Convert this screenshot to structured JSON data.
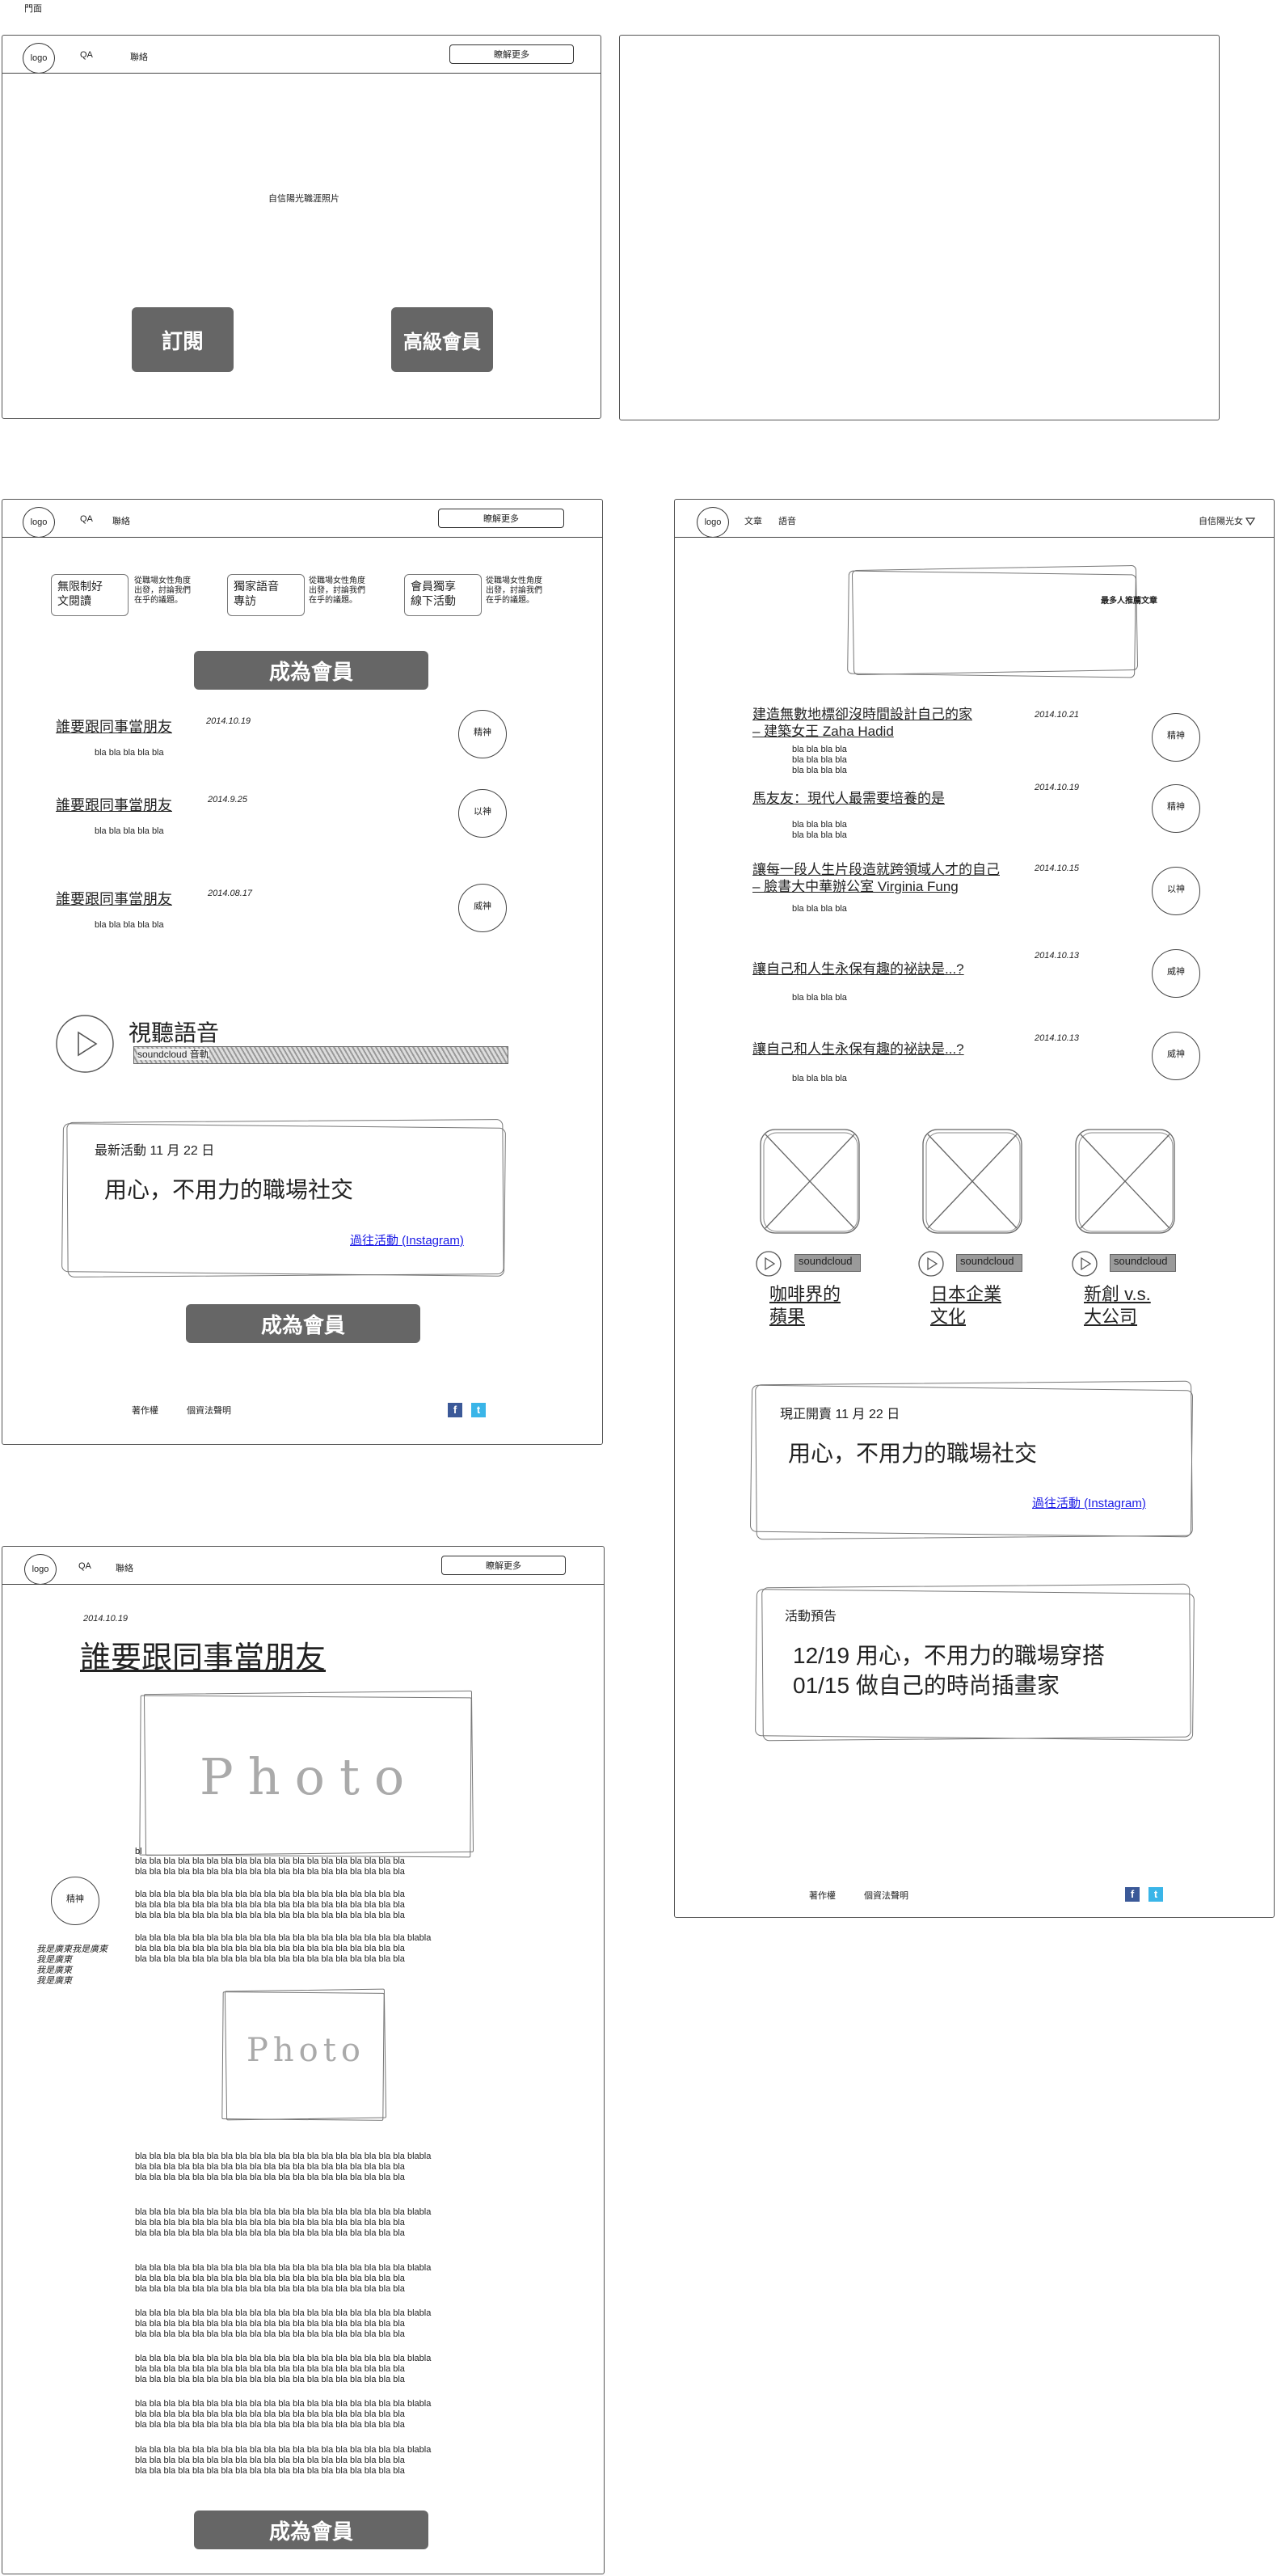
{
  "page_label": "門面",
  "common": {
    "logo": "logo",
    "bla": "bla bla bla bla bla",
    "bla_short": "bla bla bla bla",
    "copyright": "著作權",
    "privacy": "個資法聲明",
    "facebook_glyph": "f",
    "twitter_glyph": "t"
  },
  "frame1": {
    "nav_qa": "QA",
    "nav_contact": "聯絡",
    "learn_more": "瞭解更多",
    "hero_text": "自信陽光職涯照片",
    "subscribe": "訂閱",
    "premium": "高級會員"
  },
  "frame2": {
    "nav_qa": "QA",
    "nav_contact": "聯絡",
    "learn_more": "瞭解更多",
    "features": [
      {
        "title_line1": "無限制好",
        "title_line2": "文閱讀",
        "desc_line1": "從職場女性角度",
        "desc_line2": "出發，討論我們",
        "desc_line3": "在乎的議題。"
      },
      {
        "title_line1": "獨家語音",
        "title_line2": "專訪",
        "desc_line1": "從職場女性角度",
        "desc_line2": "出發，討論我們",
        "desc_line3": "在乎的議題。"
      },
      {
        "title_line1": "會員獨享",
        "title_line2": "線下活動",
        "desc_line1": "從職場女性角度",
        "desc_line2": "出發，討論我們",
        "desc_line3": "在乎的議題。"
      }
    ],
    "become_member": "成為會員",
    "articles": [
      {
        "title": "誰要跟同事當朋友",
        "date": "2014.10.19",
        "tag": "精神"
      },
      {
        "title": "誰要跟同事當朋友",
        "date": "2014.9.25",
        "tag": "以神"
      },
      {
        "title": "誰要跟同事當朋友",
        "date": "2014.08.17",
        "tag": "威神"
      }
    ],
    "audio_title": "視聽語音",
    "audio_bar": "soundcloud 音軌",
    "event_date": "最新活動 11 月 22 日",
    "event_title": "用心，不用力的職場社交",
    "event_link": "過往活動 (Instagram)",
    "become_member_2": "成為會員"
  },
  "frame3": {
    "nav_articles": "文章",
    "nav_audio": "語音",
    "user_menu": "自信陽光女",
    "user_menu_icon": "triangle-down",
    "recommended": "最多人推薦文章",
    "articles": [
      {
        "title_line1": "建造無數地標卻沒時間設計自己的家",
        "title_line2": "– 建築女王 Zaha Hadid",
        "date": "2014.10.21",
        "tag": "精神",
        "lines": 3
      },
      {
        "title_line1": "馬友友：現代人最需要培養的是",
        "title_line2": "",
        "date": "2014.10.19",
        "tag": "精神",
        "lines": 2
      },
      {
        "title_line1": "讓每一段人生片段造就跨領域人才的自己",
        "title_line2": "– 臉書大中華辦公室 Virginia Fung",
        "date": "2014.10.15",
        "tag": "以神",
        "lines": 1
      },
      {
        "title_line1": "讓自己和人生永保有趣的祕訣是...?",
        "title_line2": "",
        "date": "2014.10.13",
        "tag": "威神",
        "lines": 1
      },
      {
        "title_line1": "讓自己和人生永保有趣的祕訣是...?",
        "title_line2": "",
        "date": "2014.10.13",
        "tag": "威神",
        "lines": 1
      }
    ],
    "audio_cards": [
      {
        "sound": "soundcloud",
        "title_line1": "咖啡界的",
        "title_line2": "蘋果"
      },
      {
        "sound": "soundcloud",
        "title_line1": "日本企業",
        "title_line2": "文化"
      },
      {
        "sound": "soundcloud",
        "title_line1": "新創 v.s.",
        "title_line2": "大公司"
      }
    ],
    "event_date": "現正開賣 11 月 22 日",
    "event_title": "用心，不用力的職場社交",
    "event_link": "過往活動 (Instagram)",
    "preview_label": "活動預告",
    "preview_line1": "12/19 用心，不用力的職場穿搭",
    "preview_line2": "01/15 做自己的時尚插畫家"
  },
  "frame4": {
    "nav_qa": "QA",
    "nav_contact": "聯絡",
    "learn_more": "瞭解更多",
    "date": "2014.10.19",
    "title": "誰要跟同事當朋友",
    "photo1": "Photo",
    "photo2": "Photo",
    "tag": "精神",
    "side_line1": "我是廣東我是廣東",
    "side_line2": "我是廣東",
    "side_line3": "我是廣東",
    "side_line4": "我是廣東",
    "stray_b": "bl",
    "body_line": "bla bla bla bla bla bla bla bla bla bla bla bla bla bla bla bla bla bla bla",
    "body_line_tail": "bla bla bla bla bla bla bla bla bla bla bla bla bla bla bla bla bla bla bla  blabla",
    "become_member": "成為會員"
  }
}
